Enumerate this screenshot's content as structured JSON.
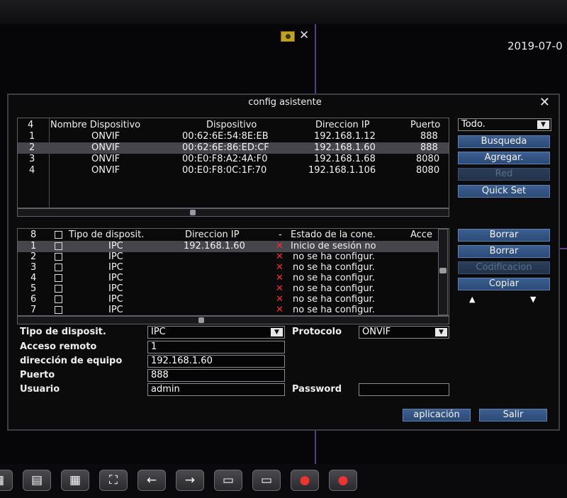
{
  "clock": "2019-07-0",
  "dialog": {
    "title": "config asistente",
    "close_glyph": "✕",
    "search_table": {
      "headers": {
        "count": "4",
        "name": "Nombre Dispositivo",
        "device": "Dispositivo",
        "ip": "Direccion IP",
        "port": "Puerto"
      },
      "rows": [
        {
          "n": "1",
          "name": "ONVIF",
          "device": "00:62:6E:54:8E:EB",
          "ip": "192.168.1.12",
          "port": "888"
        },
        {
          "n": "2",
          "name": "ONVIF",
          "device": "00:62:6E:86:ED:CF",
          "ip": "192.168.1.60",
          "port": "888"
        },
        {
          "n": "3",
          "name": "ONVIF",
          "device": "00:E0:F8:A2:4A:F0",
          "ip": "192.168.1.68",
          "port": "8080"
        },
        {
          "n": "4",
          "name": "ONVIF",
          "device": "00:E0:F8:0C:1F:70",
          "ip": "192.168.1.106",
          "port": "8080"
        }
      ]
    },
    "filter": {
      "value": "Todo."
    },
    "right_buttons": {
      "search": "Busqueda",
      "add": "Agregar.",
      "network": "Red",
      "quick_set": "Quick Set"
    },
    "added_table": {
      "headers": {
        "count": "8",
        "type": "Tipo de disposit.",
        "ip": "Direccion IP",
        "dash": "-",
        "status": "Estado de la cone.",
        "access": "Acce"
      },
      "rows": [
        {
          "n": "1",
          "type": "IPC",
          "ip": "192.168.1.60",
          "status": "Inicio de sesión no"
        },
        {
          "n": "2",
          "type": "IPC",
          "ip": "",
          "status": "no se ha configur."
        },
        {
          "n": "3",
          "type": "IPC",
          "ip": "",
          "status": "no se ha configur."
        },
        {
          "n": "4",
          "type": "IPC",
          "ip": "",
          "status": "no se ha configur."
        },
        {
          "n": "5",
          "type": "IPC",
          "ip": "",
          "status": "no se ha configur."
        },
        {
          "n": "6",
          "type": "IPC",
          "ip": "",
          "status": "no se ha configur."
        },
        {
          "n": "7",
          "type": "IPC",
          "ip": "",
          "status": "no se ha configur."
        }
      ]
    },
    "side_buttons": {
      "delete1": "Borrar",
      "delete2": "Borrar",
      "encoding": "Codificacion",
      "copy": "Copiar",
      "up": "▲",
      "down": "▼"
    },
    "form": {
      "device_type_label": "Tipo de disposit.",
      "device_type_value": "IPC",
      "protocol_label": "Protocolo",
      "protocol_value": "ONVIF",
      "remote_access_label": "Acceso remoto",
      "remote_access_value": "1",
      "address_label": "dirección de equipo",
      "address_value": "192.168.1.60",
      "port_label": "Puerto",
      "port_value": "888",
      "user_label": "Usuario",
      "user_value": "admin",
      "password_label": "Password",
      "password_value": ""
    },
    "footer": {
      "apply": "aplicación",
      "exit": "Salir"
    }
  },
  "taskbar": {
    "icons": [
      "layout-1-icon",
      "layout-4-icon",
      "layout-9-icon",
      "fullscreen-icon",
      "previous-icon",
      "next-icon",
      "camera-settings-icon",
      "camera-add-icon",
      "record-icon",
      "record-stop-icon"
    ]
  }
}
